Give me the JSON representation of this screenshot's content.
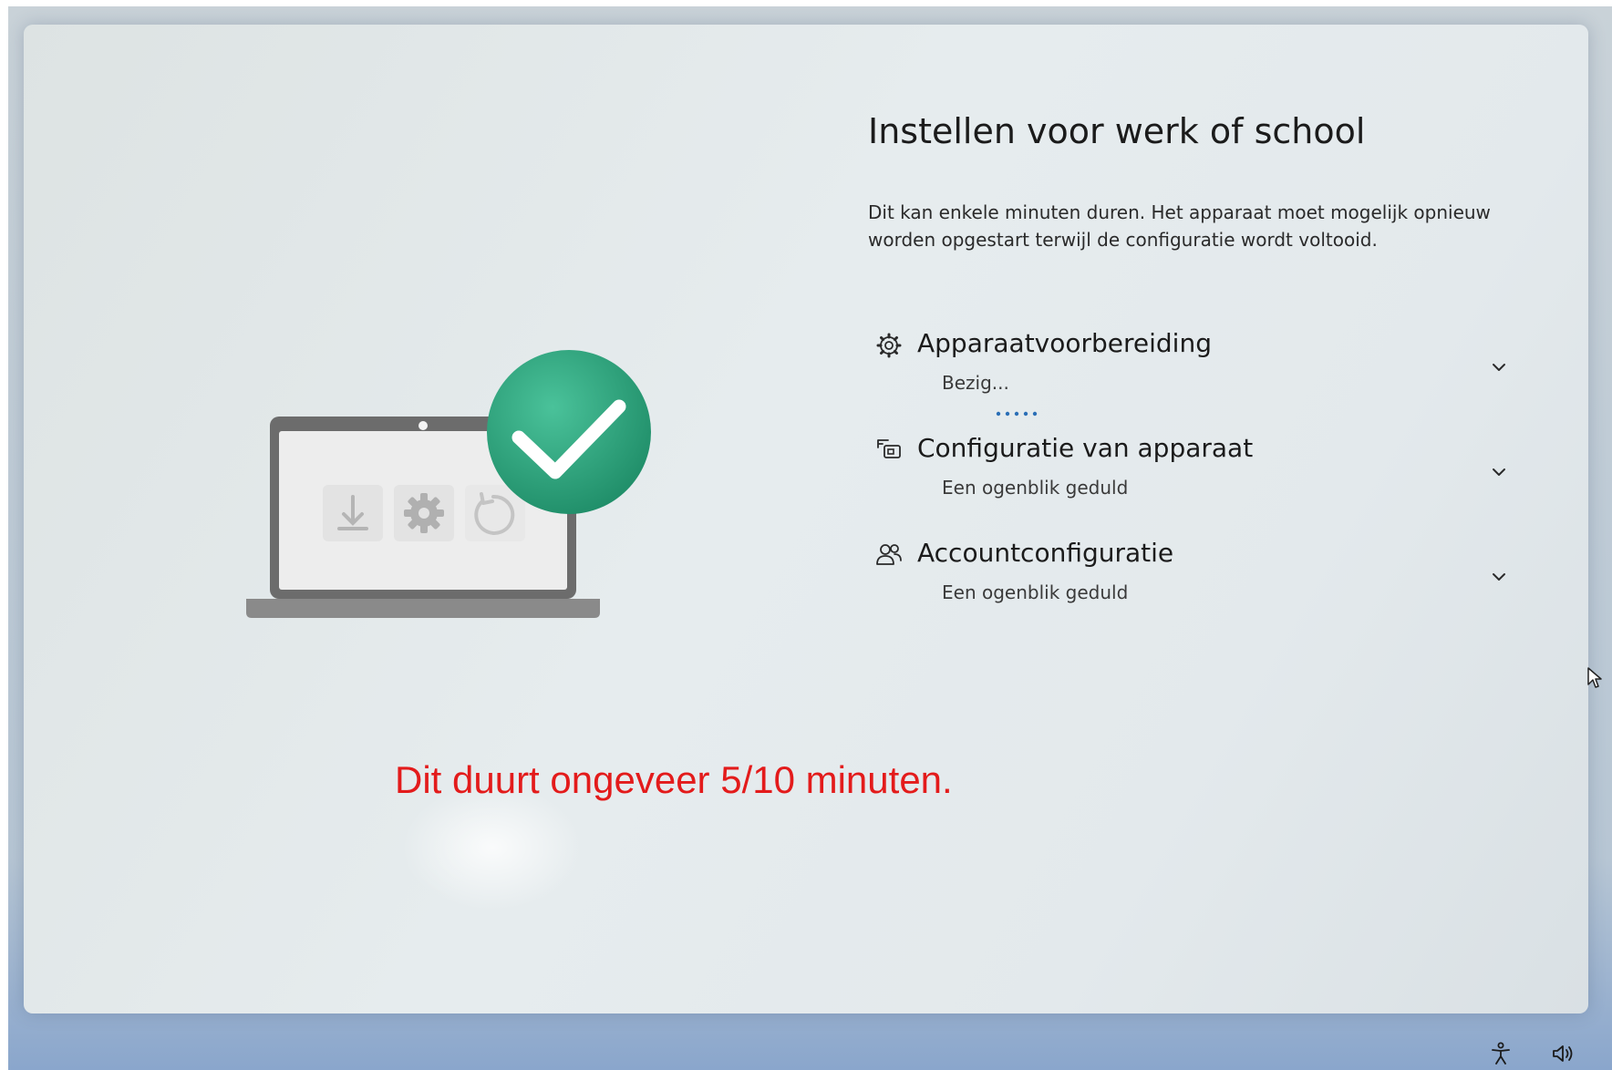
{
  "setup": {
    "title": "Instellen voor werk of school",
    "description": "Dit kan enkele minuten duren. Het apparaat moet mogelijk opnieuw worden opgestart terwijl de configuratie wordt voltooid.",
    "steps": [
      {
        "icon": "gear-icon",
        "title": "Apparaatvoorbereiding",
        "status": "Bezig..."
      },
      {
        "icon": "device-config-icon",
        "title": "Configuratie van apparaat",
        "status": "Een ogenblik geduld"
      },
      {
        "icon": "accounts-icon",
        "title": "Accountconfiguratie",
        "status": "Een ogenblik geduld"
      }
    ]
  },
  "annotation": {
    "text": "Dit duurt ongeveer 5/10 minuten.",
    "color": "#e31b1b"
  },
  "illustration": {
    "icons": [
      "download-icon",
      "gear-icon",
      "refresh-icon",
      "checkmark-icon"
    ],
    "accent": "#2fa57c"
  },
  "taskbar": {
    "icons": [
      "accessibility-icon",
      "volume-icon"
    ]
  }
}
